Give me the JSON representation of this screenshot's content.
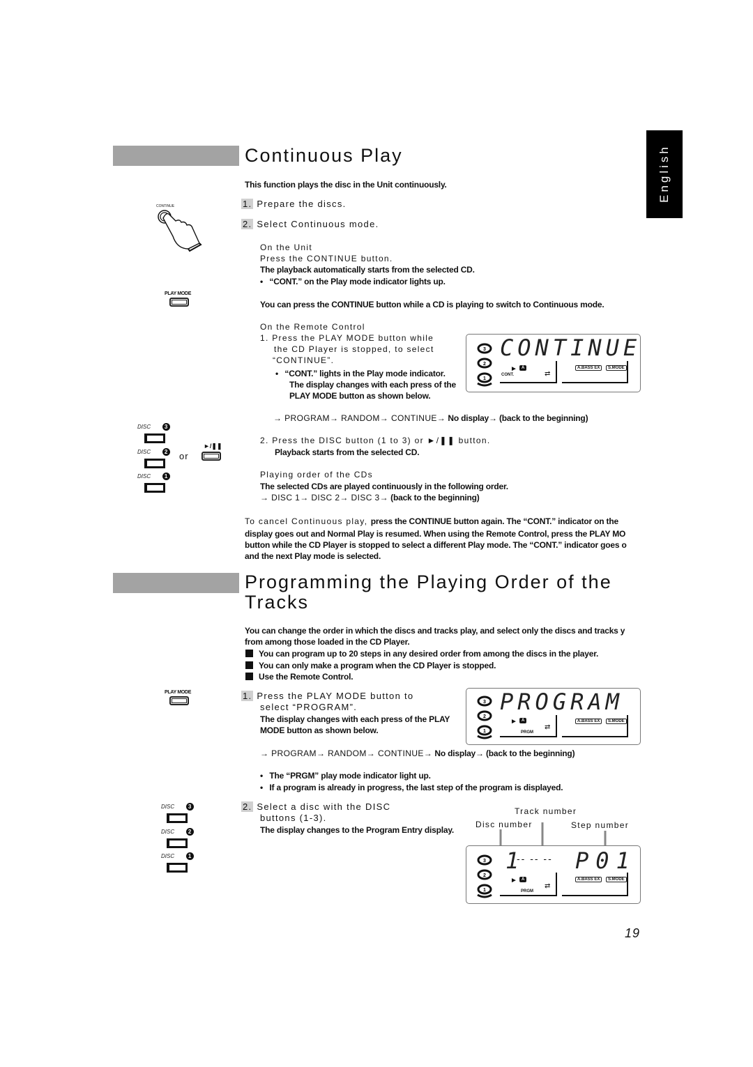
{
  "language_tab": "English",
  "page_number": "19",
  "section1": {
    "title": "Continuous Play",
    "intro": "This function plays the disc in the Unit continuously.",
    "steps": [
      {
        "num": "1.",
        "label": "Prepare the discs."
      },
      {
        "num": "2.",
        "label": "Select Continuous mode."
      }
    ],
    "unit": {
      "heading": "On the Unit",
      "instruction": "Press the CONTINUE button.",
      "bold": "The playback automatically starts from the selected CD.",
      "bullet": "“CONT.” on the Play mode indicator lights up."
    },
    "note": "You can press the CONTINUE button while a CD is playing to switch to Continuous mode.",
    "remote": {
      "heading": "On the Remote Control",
      "step1_lines": [
        "1. Press the PLAY MODE button while",
        "the CD Player is stopped, to select",
        "“CONTINUE”."
      ],
      "bullet_lines": [
        "“CONT.” lights in the Play mode indicator.",
        "The display changes with each press of the",
        "PLAY MODE button as shown below."
      ],
      "sequence_normal": "→ PROGRAM→ RANDOM→ CONTINUE→",
      "sequence_bold": " No display→ (back to the beginning)",
      "step2": "2. Press the DISC button (1 to 3) or ►/❚❚ button.",
      "step2_bold": "Playback starts from the selected CD."
    },
    "order": {
      "heading": "Playing order of the CDs",
      "bold": "The selected CDs are played continuously in the following order.",
      "sequence_normal": "→ DISC 1→ DISC 2→ DISC 3→",
      "sequence_bold": " (back to the beginning)"
    },
    "cancel": {
      "lead": "To cancel Continuous play,",
      "line1": "press the CONTINUE button again. The “CONT.” indicator on the",
      "line2": "display goes out and Normal Play is resumed. When using the Remote Control, press the PLAY MO",
      "line3": "button while the CD Player is stopped to select a different Play mode. The “CONT.” indicator goes o",
      "line4": "and the next Play mode is selected."
    },
    "lcd": {
      "text": "CONTINUE",
      "indicator": "CONT.",
      "a_badge": "A",
      "bass": "A.BASS EX",
      "smode": "S.MODE"
    },
    "icons": {
      "continue_label": "CONTINUE",
      "play_mode_label": "PLAY MODE",
      "disc_label": "DISC",
      "or": "or",
      "play_pause": "►/❚❚"
    }
  },
  "section2": {
    "title_line1": "Programming the Playing Order of the",
    "title_line2": "Tracks",
    "intro_line1": "You can change the order in which the discs and tracks play, and select only the discs and tracks y",
    "intro_line2": "from among those loaded in the CD Player.",
    "squares": [
      "You can program up to 20 steps in any desired order from among the discs in the player.",
      "You can only make a program when the CD Player is stopped.",
      "Use the Remote Control."
    ],
    "step1": {
      "num": "1.",
      "lines": [
        "Press the PLAY MODE button to",
        "select “PROGRAM”."
      ],
      "bold_lines": [
        "The display changes with each press of the PLAY",
        "MODE button as shown below."
      ],
      "sequence_normal": "→ PROGRAM→ RANDOM→ CONTINUE→",
      "sequence_bold": " No display→ (back to the beginning)",
      "bullets": [
        "The “PRGM” play mode indicator light up.",
        "If a program is already in progress, the last step of the program is displayed."
      ]
    },
    "step2": {
      "num": "2.",
      "lines": [
        "Select a disc with the DISC",
        "buttons  (1-3)."
      ],
      "bold": "The display changes to the Program Entry display."
    },
    "lcd_program": {
      "text": "PROGRAM",
      "indicator": "PRGM",
      "a_badge": "A",
      "bass": "A.BASS EX",
      "smode": "S.MODE"
    },
    "lcd_entry": {
      "disc": "1",
      "track": "-- -- --",
      "step": "P01",
      "indicator": "PRGM",
      "a_badge": "A",
      "bass": "A.BASS EX",
      "smode": "S.MODE",
      "label_track": "Track number",
      "label_disc": "Disc number",
      "label_step": "Step number"
    }
  }
}
